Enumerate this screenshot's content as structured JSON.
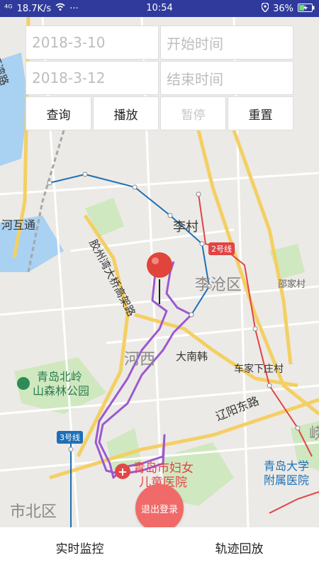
{
  "status": {
    "signal": "⁴ᴳ",
    "speed": "18.7K/s",
    "time": "10:54",
    "battery": "36%"
  },
  "controls": {
    "start_date": "2018-3-10",
    "start_time_placeholder": "开始时间",
    "end_date": "2018-3-12",
    "end_time_placeholder": "结束时间",
    "btn_query": "查询",
    "btn_play": "播放",
    "btn_pause": "暂停",
    "btn_reset": "重置"
  },
  "map": {
    "labels": {
      "huanwan": "环湾路",
      "hehutong": "河互通",
      "licun": "李村",
      "licang": "李沧区",
      "shaojiacun": "邵家村",
      "bridge": "胶州湾大桥高架路",
      "hexi": "河西",
      "danan": "大南韩",
      "chejia": "车家下庄村",
      "forest1": "青岛北岭",
      "forest2": "山森林公园",
      "liaoyang": "辽阳东路",
      "line2": "2号线",
      "line3": "3号线",
      "hosp1": "青岛市妇女",
      "hosp2": "儿童医院",
      "univ1": "青岛大学",
      "univ2": "附属医院",
      "shibei": "市北区",
      "lao": "崂"
    }
  },
  "logout_label": "退出登录",
  "tabs": {
    "realtime": "实时监控",
    "playback": "轨迹回放"
  }
}
